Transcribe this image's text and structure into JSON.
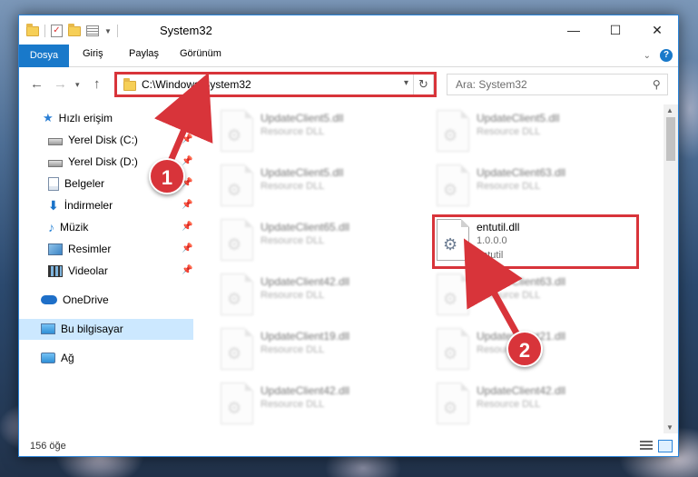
{
  "window": {
    "title": "System32",
    "minimize": "—",
    "maximize": "☐",
    "close": "✕"
  },
  "ribbon": {
    "tabs": [
      "Dosya",
      "Giriş",
      "Paylaş",
      "Görünüm"
    ]
  },
  "address": {
    "path": "C:\\Windows\\System32",
    "search_placeholder": "Ara: System32"
  },
  "sidebar": {
    "items": [
      {
        "label": "Hızlı erişim",
        "icon": "star-icon"
      },
      {
        "label": "Yerel Disk (C:)",
        "icon": "disk-icon",
        "pinned": true
      },
      {
        "label": "Yerel Disk (D:)",
        "icon": "disk-icon",
        "pinned": true
      },
      {
        "label": "Belgeler",
        "icon": "documents-icon",
        "pinned": true
      },
      {
        "label": "İndirmeler",
        "icon": "download-icon",
        "pinned": true
      },
      {
        "label": "Müzik",
        "icon": "music-icon",
        "pinned": true
      },
      {
        "label": "Resimler",
        "icon": "pictures-icon",
        "pinned": true
      },
      {
        "label": "Videolar",
        "icon": "videos-icon",
        "pinned": true
      },
      {
        "label": "OneDrive",
        "icon": "cloud-icon"
      },
      {
        "label": "Bu bilgisayar",
        "icon": "computer-icon",
        "selected": true
      },
      {
        "label": "Ağ",
        "icon": "network-icon"
      }
    ]
  },
  "files": {
    "left": [
      {
        "name": "UpdateClient5.dll",
        "type": "Resource DLL"
      },
      {
        "name": "UpdateClient5.dll",
        "type": "Resource DLL"
      },
      {
        "name": "UpdateClient65.dll",
        "type": "Resource DLL"
      },
      {
        "name": "UpdateClient42.dll",
        "type": "Resource DLL"
      },
      {
        "name": "UpdateClient19.dll",
        "type": "Resource DLL"
      },
      {
        "name": "UpdateClient42.dll",
        "type": "Resource DLL"
      }
    ],
    "right": [
      {
        "name": "UpdateClient5.dll",
        "type": "Resource DLL"
      },
      {
        "name": "UpdateClient63.dll",
        "type": "Resource DLL"
      },
      {
        "name": "entutil.dll",
        "version": "1.0.0.0",
        "desc": "entutil",
        "highlighted": true
      },
      {
        "name": "UpdateClient63.dll",
        "type": "Resource DLL"
      },
      {
        "name": "UpdateClient21.dll",
        "type": "Resource DLL"
      },
      {
        "name": "UpdateClient42.dll",
        "type": "Resource DLL"
      }
    ]
  },
  "status": {
    "item_count": "156 öğe"
  },
  "annotations": {
    "badge1": "1",
    "badge2": "2",
    "accent": "#d8343a"
  }
}
